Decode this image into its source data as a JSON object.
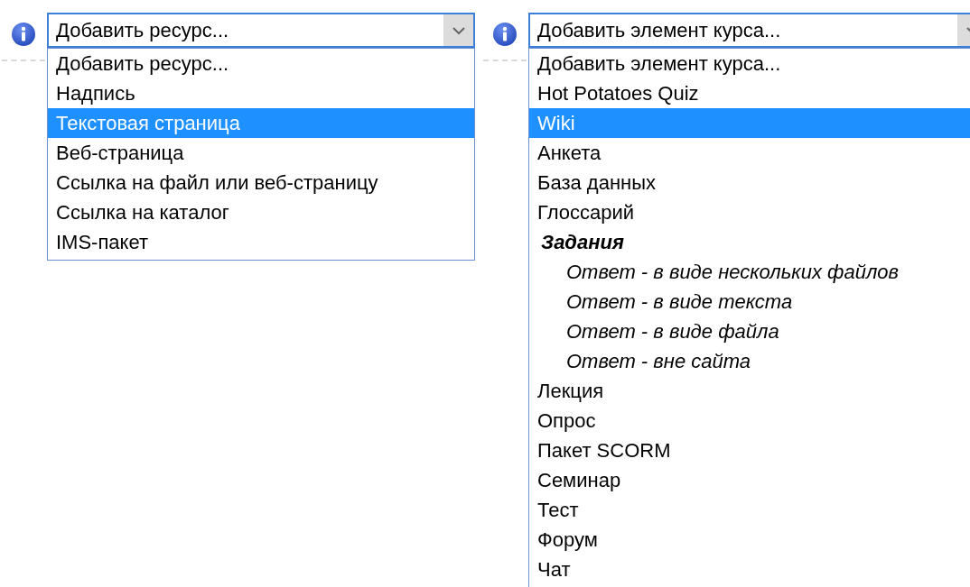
{
  "selects": [
    {
      "value": "Добавить ресурс...",
      "options": [
        {
          "kind": "option",
          "label": "Добавить ресурс...",
          "highlighted": false
        },
        {
          "kind": "option",
          "label": "Надпись",
          "highlighted": false
        },
        {
          "kind": "option",
          "label": "Текстовая страница",
          "highlighted": true
        },
        {
          "kind": "option",
          "label": "Веб-страница",
          "highlighted": false
        },
        {
          "kind": "option",
          "label": "Ссылка на файл или веб-страницу",
          "highlighted": false
        },
        {
          "kind": "option",
          "label": "Ссылка на каталог",
          "highlighted": false
        },
        {
          "kind": "option",
          "label": "IMS-пакет",
          "highlighted": false
        }
      ]
    },
    {
      "value": "Добавить элемент курса...",
      "options": [
        {
          "kind": "option",
          "label": "Добавить элемент курса...",
          "highlighted": false
        },
        {
          "kind": "option",
          "label": "Hot Potatoes Quiz",
          "highlighted": false
        },
        {
          "kind": "option",
          "label": "Wiki",
          "highlighted": true
        },
        {
          "kind": "option",
          "label": "Анкета",
          "highlighted": false
        },
        {
          "kind": "option",
          "label": "База данных",
          "highlighted": false
        },
        {
          "kind": "option",
          "label": "Глоссарий",
          "highlighted": false
        },
        {
          "kind": "group",
          "label": "Задания",
          "children": [
            {
              "kind": "option",
              "label": "Ответ - в виде нескольких файлов",
              "highlighted": false
            },
            {
              "kind": "option",
              "label": "Ответ - в виде текста",
              "highlighted": false
            },
            {
              "kind": "option",
              "label": "Ответ - в виде файла",
              "highlighted": false
            },
            {
              "kind": "option",
              "label": "Ответ - вне сайта",
              "highlighted": false
            }
          ]
        },
        {
          "kind": "option",
          "label": "Лекция",
          "highlighted": false
        },
        {
          "kind": "option",
          "label": "Опрос",
          "highlighted": false
        },
        {
          "kind": "option",
          "label": "Пакет SCORM",
          "highlighted": false
        },
        {
          "kind": "option",
          "label": "Семинар",
          "highlighted": false
        },
        {
          "kind": "option",
          "label": "Тест",
          "highlighted": false
        },
        {
          "kind": "option",
          "label": "Форум",
          "highlighted": false
        },
        {
          "kind": "option",
          "label": "Чат",
          "highlighted": false
        }
      ]
    }
  ]
}
